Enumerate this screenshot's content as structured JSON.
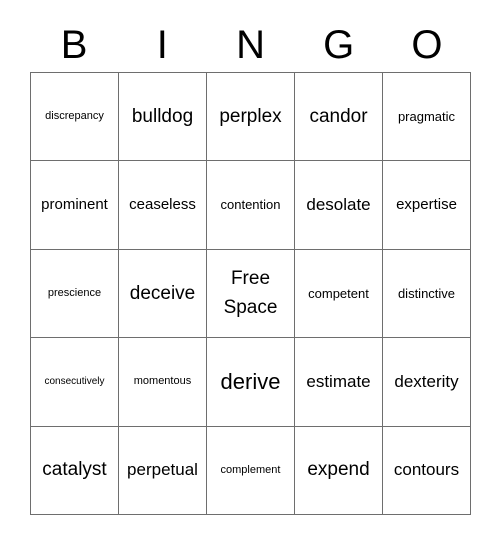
{
  "card": {
    "headers": [
      "B",
      "I",
      "N",
      "G",
      "O"
    ],
    "rows": [
      [
        {
          "text": "discrepancy",
          "size": "sm"
        },
        {
          "text": "bulldog",
          "size": "xxl"
        },
        {
          "text": "perplex",
          "size": "xxl"
        },
        {
          "text": "candor",
          "size": "xxl"
        },
        {
          "text": "pragmatic",
          "size": "md"
        }
      ],
      [
        {
          "text": "prominent",
          "size": "lg"
        },
        {
          "text": "ceaseless",
          "size": "lg"
        },
        {
          "text": "contention",
          "size": "md"
        },
        {
          "text": "desolate",
          "size": "xl"
        },
        {
          "text": "expertise",
          "size": "lg"
        }
      ],
      [
        {
          "text": "prescience",
          "size": "sm"
        },
        {
          "text": "deceive",
          "size": "xxl"
        },
        {
          "text": "Free Space",
          "size": "xxl",
          "free_space": true,
          "line1": "Free",
          "line2": "Space"
        },
        {
          "text": "competent",
          "size": "md"
        },
        {
          "text": "distinctive",
          "size": "md"
        }
      ],
      [
        {
          "text": "consecutively",
          "size": "xs"
        },
        {
          "text": "momentous",
          "size": "sm"
        },
        {
          "text": "derive",
          "size": "xxxl"
        },
        {
          "text": "estimate",
          "size": "xl"
        },
        {
          "text": "dexterity",
          "size": "xl"
        }
      ],
      [
        {
          "text": "catalyst",
          "size": "xxl"
        },
        {
          "text": "perpetual",
          "size": "xl"
        },
        {
          "text": "complement",
          "size": "sm"
        },
        {
          "text": "expend",
          "size": "xxl"
        },
        {
          "text": "contours",
          "size": "xl"
        }
      ]
    ]
  },
  "colors": {
    "border": "#6e6e6e",
    "background": "#ffffff",
    "text": "#000000"
  }
}
